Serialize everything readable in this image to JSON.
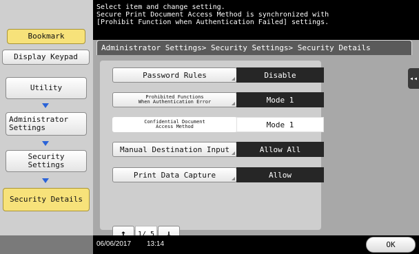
{
  "left_panel": {
    "bookmark": "Bookmark",
    "display_keypad": "Display Keypad",
    "breadcrumb": [
      {
        "label": "Utility"
      },
      {
        "label": "Administrator\nSettings"
      },
      {
        "label": "Security\nSettings"
      },
      {
        "label": "Security Details"
      }
    ]
  },
  "message": {
    "line1": "Select item and change setting.",
    "line2": "Secure Print Document Access Method is synchronized with",
    "line3": "[Prohibit Function when Authentication Failed] settings."
  },
  "header": {
    "path": "Administrator Settings> Security Settings> Security Details",
    "side_tab": "◂◂"
  },
  "settings": [
    {
      "label": "Password Rules",
      "value": "Disable"
    },
    {
      "label": "Prohibited Functions\nWhen Authentication Error",
      "value": "Mode 1"
    },
    {
      "label": "Confidential Document\nAccess Method",
      "value": "Mode 1"
    },
    {
      "label": "Manual Destination Input",
      "value": "Allow All"
    },
    {
      "label": "Print Data Capture",
      "value": "Allow"
    }
  ],
  "pager": {
    "up": "↑",
    "page": "1/ 5",
    "down": "↓"
  },
  "status": {
    "date": "06/06/2017",
    "time": "13:14"
  },
  "ok_button": "OK",
  "colors": {
    "accent_yellow": "#f7e27a",
    "arrow_blue": "#2a63d8",
    "value_dark": "#262626"
  }
}
